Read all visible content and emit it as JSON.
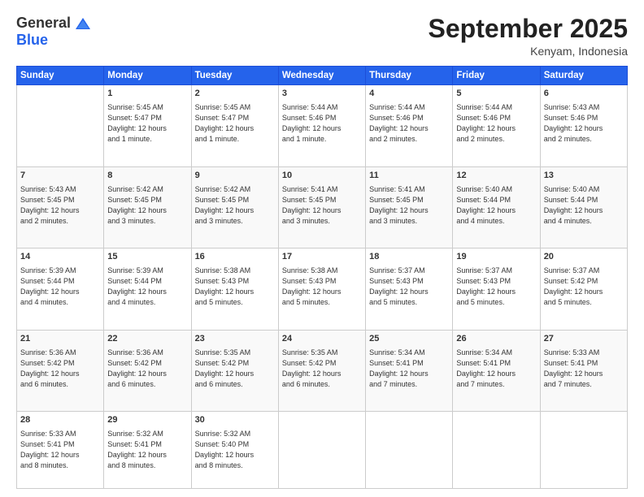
{
  "logo": {
    "general": "General",
    "blue": "Blue"
  },
  "title": "September 2025",
  "location": "Kenyam, Indonesia",
  "days": [
    "Sunday",
    "Monday",
    "Tuesday",
    "Wednesday",
    "Thursday",
    "Friday",
    "Saturday"
  ],
  "weeks": [
    [
      {
        "num": "",
        "info": ""
      },
      {
        "num": "1",
        "info": "Sunrise: 5:45 AM\nSunset: 5:47 PM\nDaylight: 12 hours\nand 1 minute."
      },
      {
        "num": "2",
        "info": "Sunrise: 5:45 AM\nSunset: 5:47 PM\nDaylight: 12 hours\nand 1 minute."
      },
      {
        "num": "3",
        "info": "Sunrise: 5:44 AM\nSunset: 5:46 PM\nDaylight: 12 hours\nand 1 minute."
      },
      {
        "num": "4",
        "info": "Sunrise: 5:44 AM\nSunset: 5:46 PM\nDaylight: 12 hours\nand 2 minutes."
      },
      {
        "num": "5",
        "info": "Sunrise: 5:44 AM\nSunset: 5:46 PM\nDaylight: 12 hours\nand 2 minutes."
      },
      {
        "num": "6",
        "info": "Sunrise: 5:43 AM\nSunset: 5:46 PM\nDaylight: 12 hours\nand 2 minutes."
      }
    ],
    [
      {
        "num": "7",
        "info": "Sunrise: 5:43 AM\nSunset: 5:45 PM\nDaylight: 12 hours\nand 2 minutes."
      },
      {
        "num": "8",
        "info": "Sunrise: 5:42 AM\nSunset: 5:45 PM\nDaylight: 12 hours\nand 3 minutes."
      },
      {
        "num": "9",
        "info": "Sunrise: 5:42 AM\nSunset: 5:45 PM\nDaylight: 12 hours\nand 3 minutes."
      },
      {
        "num": "10",
        "info": "Sunrise: 5:41 AM\nSunset: 5:45 PM\nDaylight: 12 hours\nand 3 minutes."
      },
      {
        "num": "11",
        "info": "Sunrise: 5:41 AM\nSunset: 5:45 PM\nDaylight: 12 hours\nand 3 minutes."
      },
      {
        "num": "12",
        "info": "Sunrise: 5:40 AM\nSunset: 5:44 PM\nDaylight: 12 hours\nand 4 minutes."
      },
      {
        "num": "13",
        "info": "Sunrise: 5:40 AM\nSunset: 5:44 PM\nDaylight: 12 hours\nand 4 minutes."
      }
    ],
    [
      {
        "num": "14",
        "info": "Sunrise: 5:39 AM\nSunset: 5:44 PM\nDaylight: 12 hours\nand 4 minutes."
      },
      {
        "num": "15",
        "info": "Sunrise: 5:39 AM\nSunset: 5:44 PM\nDaylight: 12 hours\nand 4 minutes."
      },
      {
        "num": "16",
        "info": "Sunrise: 5:38 AM\nSunset: 5:43 PM\nDaylight: 12 hours\nand 5 minutes."
      },
      {
        "num": "17",
        "info": "Sunrise: 5:38 AM\nSunset: 5:43 PM\nDaylight: 12 hours\nand 5 minutes."
      },
      {
        "num": "18",
        "info": "Sunrise: 5:37 AM\nSunset: 5:43 PM\nDaylight: 12 hours\nand 5 minutes."
      },
      {
        "num": "19",
        "info": "Sunrise: 5:37 AM\nSunset: 5:43 PM\nDaylight: 12 hours\nand 5 minutes."
      },
      {
        "num": "20",
        "info": "Sunrise: 5:37 AM\nSunset: 5:42 PM\nDaylight: 12 hours\nand 5 minutes."
      }
    ],
    [
      {
        "num": "21",
        "info": "Sunrise: 5:36 AM\nSunset: 5:42 PM\nDaylight: 12 hours\nand 6 minutes."
      },
      {
        "num": "22",
        "info": "Sunrise: 5:36 AM\nSunset: 5:42 PM\nDaylight: 12 hours\nand 6 minutes."
      },
      {
        "num": "23",
        "info": "Sunrise: 5:35 AM\nSunset: 5:42 PM\nDaylight: 12 hours\nand 6 minutes."
      },
      {
        "num": "24",
        "info": "Sunrise: 5:35 AM\nSunset: 5:42 PM\nDaylight: 12 hours\nand 6 minutes."
      },
      {
        "num": "25",
        "info": "Sunrise: 5:34 AM\nSunset: 5:41 PM\nDaylight: 12 hours\nand 7 minutes."
      },
      {
        "num": "26",
        "info": "Sunrise: 5:34 AM\nSunset: 5:41 PM\nDaylight: 12 hours\nand 7 minutes."
      },
      {
        "num": "27",
        "info": "Sunrise: 5:33 AM\nSunset: 5:41 PM\nDaylight: 12 hours\nand 7 minutes."
      }
    ],
    [
      {
        "num": "28",
        "info": "Sunrise: 5:33 AM\nSunset: 5:41 PM\nDaylight: 12 hours\nand 8 minutes."
      },
      {
        "num": "29",
        "info": "Sunrise: 5:32 AM\nSunset: 5:41 PM\nDaylight: 12 hours\nand 8 minutes."
      },
      {
        "num": "30",
        "info": "Sunrise: 5:32 AM\nSunset: 5:40 PM\nDaylight: 12 hours\nand 8 minutes."
      },
      {
        "num": "",
        "info": ""
      },
      {
        "num": "",
        "info": ""
      },
      {
        "num": "",
        "info": ""
      },
      {
        "num": "",
        "info": ""
      }
    ]
  ]
}
